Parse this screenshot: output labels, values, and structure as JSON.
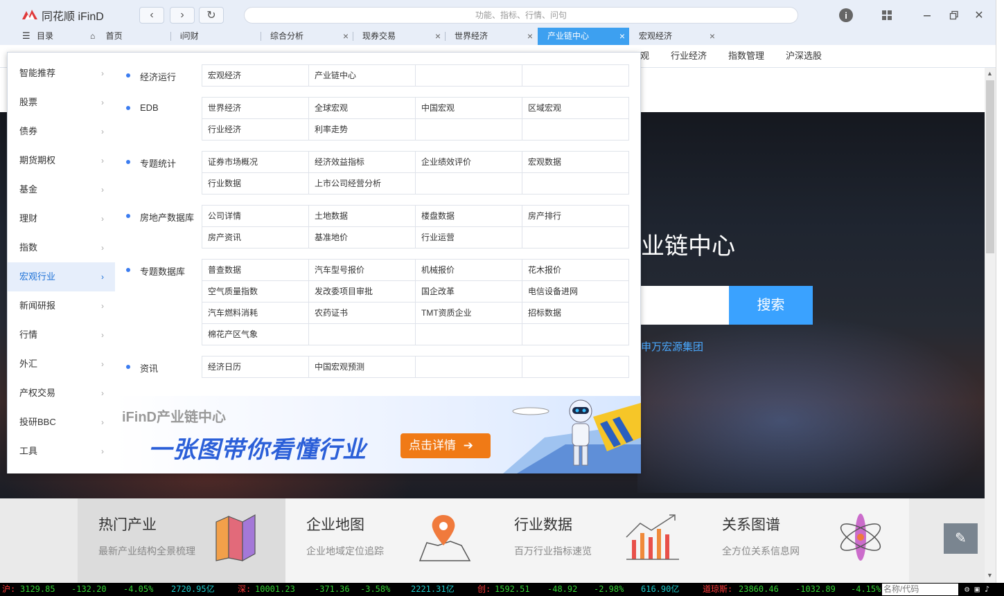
{
  "app": {
    "title": "同花顺 iFinD"
  },
  "search": {
    "placeholder": "功能、指标、行情、问句"
  },
  "tabs": {
    "catalog": "目录",
    "home": "首页",
    "items": [
      {
        "label": "i问财",
        "closable": false
      },
      {
        "label": "综合分析",
        "closable": true
      },
      {
        "label": "现券交易",
        "closable": true
      },
      {
        "label": "世界经济",
        "closable": true
      },
      {
        "label": "产业链中心",
        "closable": true,
        "active": true
      },
      {
        "label": "宏观经济",
        "closable": true
      }
    ]
  },
  "subnav": [
    "观",
    "行业经济",
    "指数管理",
    "沪深选股"
  ],
  "hero": {
    "title": "业链中心",
    "search_button": "搜索",
    "link": "申万宏源集团"
  },
  "cards": [
    {
      "title": "热门产业",
      "desc": "最新产业结构全景梳理",
      "icon": "bar-columns-icon"
    },
    {
      "title": "企业地图",
      "desc": "企业地域定位追踪",
      "icon": "map-pin-icon"
    },
    {
      "title": "行业数据",
      "desc": "百万行业指标速览",
      "icon": "trend-chart-icon"
    },
    {
      "title": "关系图谱",
      "desc": "全方位关系信息网",
      "icon": "atom-icon"
    }
  ],
  "menu": {
    "categories": [
      "智能推荐",
      "股票",
      "债券",
      "期货期权",
      "基金",
      "理财",
      "指数",
      "宏观行业",
      "新闻研报",
      "行情",
      "外汇",
      "产权交易",
      "投研BBC",
      "工具"
    ],
    "active_category": "宏观行业",
    "groups": [
      {
        "label": "经济运行",
        "rows": [
          [
            "宏观经济",
            "产业链中心",
            "",
            ""
          ]
        ]
      },
      {
        "label": "EDB",
        "rows": [
          [
            "世界经济",
            "全球宏观",
            "中国宏观",
            "区域宏观"
          ],
          [
            "行业经济",
            "利率走势",
            "",
            ""
          ]
        ]
      },
      {
        "label": "专题统计",
        "rows": [
          [
            "证券市场概况",
            "经济效益指标",
            "企业绩效评价",
            "宏观数据"
          ],
          [
            "行业数据",
            "上市公司经营分析",
            "",
            ""
          ]
        ]
      },
      {
        "label": "房地产数据库",
        "rows": [
          [
            "公司详情",
            "土地数据",
            "楼盘数据",
            "房产排行"
          ],
          [
            "房产资讯",
            "基准地价",
            "行业运营",
            ""
          ]
        ]
      },
      {
        "label": "专题数据库",
        "rows": [
          [
            "普查数据",
            "汽车型号报价",
            "机械报价",
            "花木报价"
          ],
          [
            "空气质量指数",
            "发改委项目审批",
            "国企改革",
            "电信设备进网"
          ],
          [
            "汽车燃料消耗",
            "农药证书",
            "TMT资质企业",
            "招标数据"
          ],
          [
            "棉花产区气象",
            "",
            "",
            ""
          ]
        ]
      },
      {
        "label": "资讯",
        "rows": [
          [
            "经济日历",
            "中国宏观预测",
            "",
            ""
          ]
        ]
      }
    ],
    "banner": {
      "title": "iFinD产业链中心",
      "slogan": "一张图带你看懂行业",
      "button": "点击详情"
    }
  },
  "ticker": {
    "sh": {
      "label": "沪:",
      "price": "3129.85",
      "change": "-132.20",
      "pct": "-4.05%",
      "amount": "2720.95亿"
    },
    "sz": {
      "label": "深:",
      "price": "10001.23",
      "change": "-371.36",
      "pct": "-3.58%",
      "amount": "2221.31亿"
    },
    "cy": {
      "label": "创:",
      "price": "1592.51",
      "change": "-48.92",
      "pct": "-2.98%",
      "amount": "616.90亿"
    },
    "dj": {
      "label": "道琼斯:",
      "price": "23860.46",
      "change": "-1032.89",
      "pct": "-4.15%"
    },
    "input_placeholder": "名称/代码"
  },
  "colors": {
    "accent": "#3da0f0",
    "ticker_red": "#ff3b3b",
    "ticker_green": "#32d232"
  }
}
